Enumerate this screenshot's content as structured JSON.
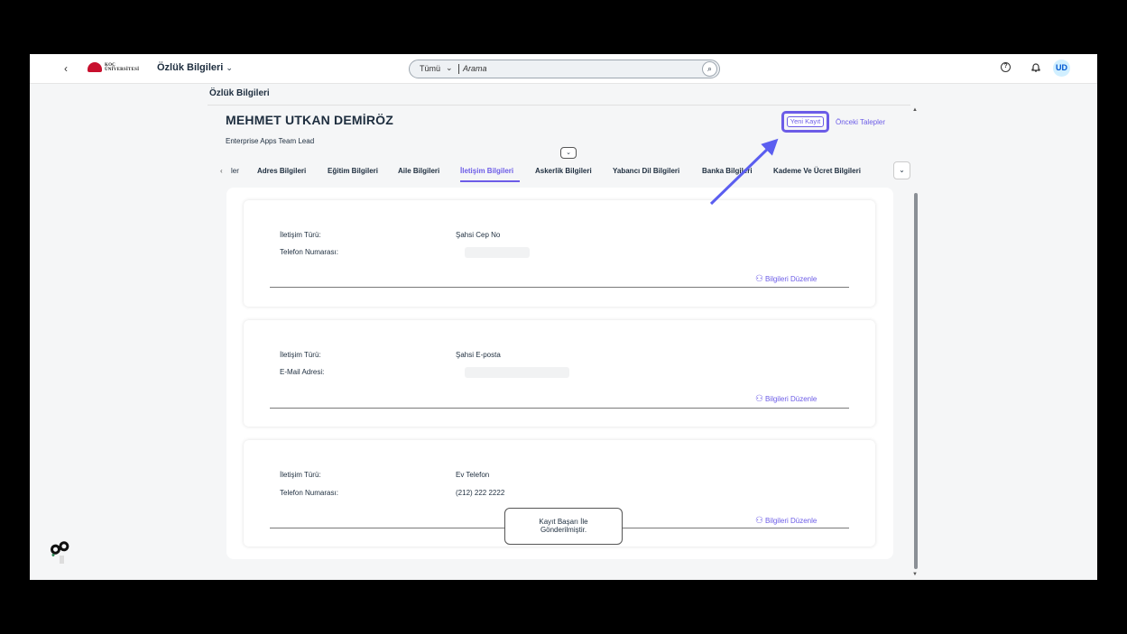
{
  "shell": {
    "back_icon": "‹",
    "logo_text_line1": "KOÇ",
    "logo_text_line2": "ÜNİVERSİTESİ",
    "app_title": "Özlük Bilgileri",
    "search_scope": "Tümü",
    "search_placeholder": "Arama",
    "help_icon": "?",
    "avatar_initials": "UD"
  },
  "page": {
    "title": "Özlük Bilgileri",
    "employee_name": "MEHMET UTKAN DEMİRÖZ",
    "employee_role": "Enterprise Apps Team Lead",
    "yeni_kayit": "Yeni Kayıt",
    "onceki_talepler": "Önceki Talepler",
    "accent_color": "#6c5ce7"
  },
  "tabs": [
    {
      "label": "ler"
    },
    {
      "label": "Adres Bilgileri"
    },
    {
      "label": "Eğitim Bilgileri"
    },
    {
      "label": "Aile Bilgileri"
    },
    {
      "label": "İletişim Bilgileri",
      "active": true
    },
    {
      "label": "Askerlik Bilgileri"
    },
    {
      "label": "Yabancı Dil Bilgileri"
    },
    {
      "label": "Banka Bilgileri"
    },
    {
      "label": "Kademe Ve Ücret Bilgileri"
    }
  ],
  "cards": [
    {
      "type_label": "İletişim Türü:",
      "type_value": "Şahsi Cep No",
      "field_label": "Telefon Numarası:",
      "field_value": "",
      "edit_label": "Bilgileri Düzenle"
    },
    {
      "type_label": "İletişim Türü:",
      "type_value": "Şahsi E-posta",
      "field_label": "E-Mail Adresi:",
      "field_value": "",
      "edit_label": "Bilgileri Düzenle"
    },
    {
      "type_label": "İletişim Türü:",
      "type_value": "Ev Telefon",
      "field_label": "Telefon Numarası:",
      "field_value": "(212) 222 2222",
      "edit_label": "Bilgileri Düzenle"
    }
  ],
  "toast": {
    "line1": "Kayıt Başarı İle",
    "line2": "Gönderilmiştir."
  }
}
